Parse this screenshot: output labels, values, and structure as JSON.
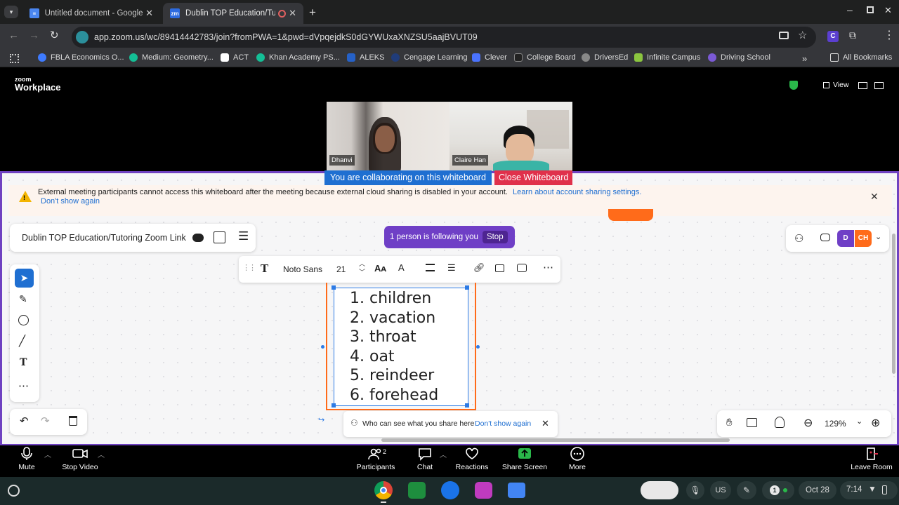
{
  "browser": {
    "tabs": [
      {
        "title": "Untitled document - Google Do",
        "icon": "google-docs-icon"
      },
      {
        "title": "Dublin TOP Education/Tuto",
        "icon": "zoom-icon"
      }
    ],
    "url": "app.zoom.us/wc/89414442783/join?fromPWA=1&pwd=dVpqejdkS0dGYWUxaXNZSU5aajBVUT09",
    "bookmarks": [
      "FBLA Economics O...",
      "Medium: Geometry...",
      "ACT",
      "Khan Academy PS...",
      "ALEKS",
      "Cengage Learning",
      "Clever",
      "College Board",
      "DriversEd",
      "Infinite Campus",
      "Driving School"
    ],
    "all_bookmarks": "All Bookmarks"
  },
  "zoom": {
    "brand_small": "zoom",
    "brand": "Workplace",
    "view_label": "View",
    "participants_video": [
      "Dhanvi",
      "Claire Han"
    ],
    "collab_label": "You are collaborating on this whiteboard",
    "close_wb_label": "Close Whiteboard"
  },
  "notice": {
    "text": "External meeting participants cannot access this whiteboard after the meeting because external cloud sharing is disabled in your account.",
    "link": "Learn about account sharing settings.",
    "dont_show": "Don't show again"
  },
  "whiteboard": {
    "title": "Dublin TOP Education/Tutoring Zoom Link",
    "following": "1 person is following you",
    "stop": "Stop",
    "avatars": [
      "D",
      "CH"
    ],
    "font_name": "Noto Sans",
    "font_size": "21",
    "list_items": [
      "1. children",
      "2. vacation",
      "3. throat",
      "4. oat",
      "5. reindeer",
      "6. forehead"
    ],
    "share_hint": "Who can see what you share here",
    "share_dont_show": "Don't show again",
    "zoom_level": "129%",
    "colors": {
      "accent": "#6f42c1",
      "selection": "#2d7be5",
      "orange": "#ff6b1a"
    }
  },
  "controls": {
    "mute": "Mute",
    "stop_video": "Stop Video",
    "participants": "Participants",
    "participants_count": "2",
    "chat": "Chat",
    "reactions": "Reactions",
    "share_screen": "Share Screen",
    "more": "More",
    "leave": "Leave Room"
  },
  "shelf": {
    "locale": "US",
    "notification_count": "1",
    "date": "Oct 28",
    "time": "7:14"
  }
}
